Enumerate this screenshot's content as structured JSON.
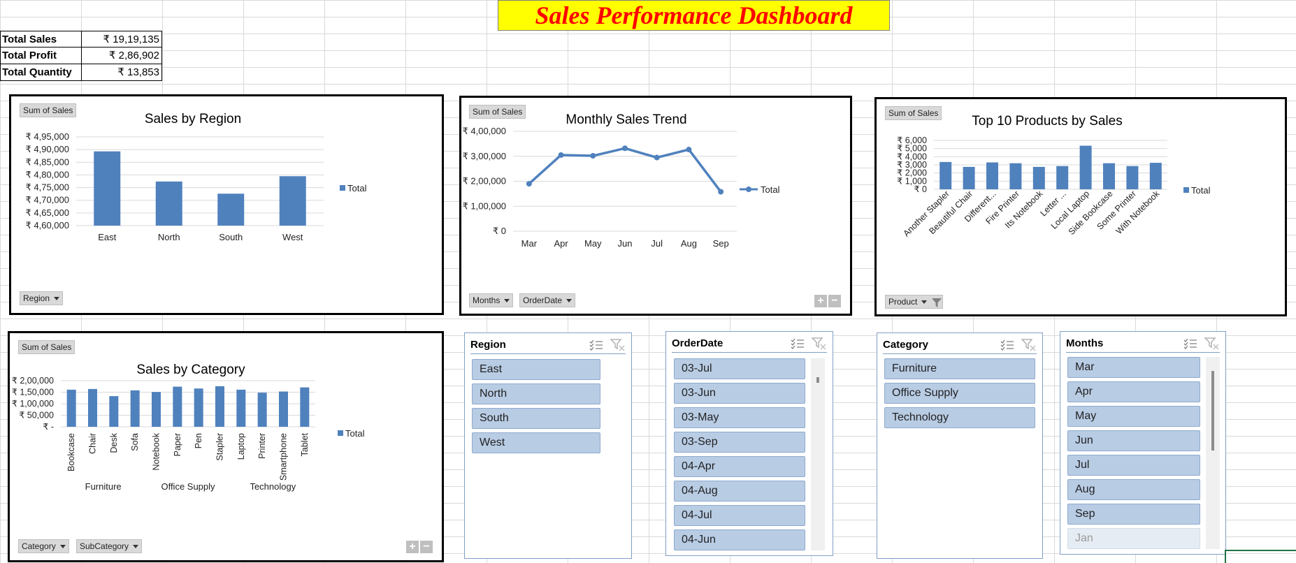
{
  "title": "Sales Performance Dashboard",
  "kpis": [
    {
      "label": "Total Sales",
      "value": "₹ 19,19,135"
    },
    {
      "label": "Total Profit",
      "value": "₹ 2,86,902"
    },
    {
      "label": "Total Quantity",
      "value": "₹ 13,853"
    }
  ],
  "chart_data": [
    {
      "type": "bar",
      "title": "Sales by Region",
      "value_field": "Sum of Sales",
      "categories": [
        "East",
        "North",
        "South",
        "West"
      ],
      "series": [
        {
          "name": "Total",
          "values": [
            489300,
            477400,
            472600,
            479500
          ]
        }
      ],
      "ylim": [
        460000,
        495000
      ],
      "yticks": [
        "₹ 4,60,000",
        "₹ 4,65,000",
        "₹ 4,70,000",
        "₹ 4,75,000",
        "₹ 4,80,000",
        "₹ 4,85,000",
        "₹ 4,90,000",
        "₹ 4,95,000"
      ],
      "legend": "right",
      "filters": [
        "Region"
      ]
    },
    {
      "type": "line",
      "title": "Monthly Sales Trend",
      "value_field": "Sum of Sales",
      "categories": [
        "Mar",
        "Apr",
        "May",
        "Jun",
        "Jul",
        "Aug",
        "Sep"
      ],
      "series": [
        {
          "name": "Total",
          "values": [
            190000,
            305000,
            302000,
            332000,
            295000,
            327000,
            158000
          ]
        }
      ],
      "ylim": [
        0,
        400000
      ],
      "yticks": [
        "₹ 0",
        "₹ 1,00,000",
        "₹ 2,00,000",
        "₹ 3,00,000",
        "₹ 4,00,000"
      ],
      "legend": "right",
      "filters": [
        "Months",
        "OrderDate"
      ]
    },
    {
      "type": "bar",
      "title": "Top 10 Products by Sales",
      "value_field": "Sum of Sales",
      "categories": [
        "Another Stapler",
        "Beautiful Chair",
        "Different...",
        "Fire Printer",
        "Its Notebook",
        "Letter ...",
        "Local Laptop",
        "Side Bookcase",
        "Some Printer",
        "With Notebook"
      ],
      "series": [
        {
          "name": "Total",
          "values": [
            3350,
            2750,
            3300,
            3200,
            2750,
            2850,
            5350,
            3200,
            2850,
            3250
          ]
        }
      ],
      "ylim": [
        0,
        6000
      ],
      "yticks": [
        "₹ 0",
        "₹ 1,000",
        "₹ 2,000",
        "₹ 3,000",
        "₹ 4,000",
        "₹ 5,000",
        "₹ 6,000"
      ],
      "legend": "right",
      "filters": [
        "Product"
      ]
    },
    {
      "type": "bar",
      "title": "Sales by Category",
      "value_field": "Sum of Sales",
      "categories": [
        "Bookcase",
        "Chair",
        "Desk",
        "Sofa",
        "Notebook",
        "Paper",
        "Pen",
        "Stapler",
        "Laptop",
        "Printer",
        "Smartphone",
        "Tablet"
      ],
      "groups": [
        {
          "name": "Furniture",
          "count": 4
        },
        {
          "name": "Office Supply",
          "count": 4
        },
        {
          "name": "Technology",
          "count": 4
        }
      ],
      "series": [
        {
          "name": "Total",
          "values": [
            161000,
            164000,
            133000,
            158000,
            151000,
            174000,
            166000,
            176000,
            161000,
            148000,
            153000,
            171000
          ]
        }
      ],
      "ylim": [
        0,
        200000
      ],
      "yticks": [
        "₹ -",
        "₹ 50,000",
        "₹ 1,00,000",
        "₹ 1,50,000",
        "₹ 2,00,000"
      ],
      "legend": "right",
      "filters": [
        "Category",
        "SubCategory"
      ]
    }
  ],
  "slicers": {
    "region": {
      "title": "Region",
      "items": [
        "East",
        "North",
        "South",
        "West"
      ]
    },
    "orderdate": {
      "title": "OrderDate",
      "items": [
        "03-Jul",
        "03-Jun",
        "03-May",
        "03-Sep",
        "04-Apr",
        "04-Aug",
        "04-Jul",
        "04-Jun"
      ]
    },
    "category": {
      "title": "Category",
      "items": [
        "Furniture",
        "Office Supply",
        "Technology"
      ]
    },
    "months": {
      "title": "Months",
      "items": [
        "Mar",
        "Apr",
        "May",
        "Jun",
        "Jul",
        "Aug",
        "Sep"
      ],
      "disabled_items": [
        "Jan"
      ]
    }
  },
  "colors": {
    "bar": "#4f81bd",
    "title_bg": "#ffff00",
    "title_text": "#ff0000",
    "slicer_item": "#b8cce4"
  },
  "icons": [
    "multi-select-icon",
    "clear-filter-icon",
    "funnel-filter-icon",
    "expand-icon",
    "collapse-icon"
  ]
}
